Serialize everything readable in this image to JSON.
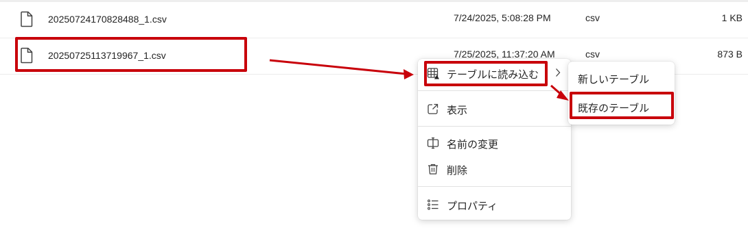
{
  "files": [
    {
      "name": "20250724170828488_1.csv",
      "modified": "7/24/2025, 5:08:28 PM",
      "type": "csv",
      "size": "1 KB",
      "icon": "file-icon"
    },
    {
      "name": "20250725113719967_1.csv",
      "modified": "7/25/2025, 11:37:20 AM",
      "type": "csv",
      "size": "873 B",
      "icon": "file-icon"
    }
  ],
  "context_menu": {
    "import_to_table": {
      "label": "テーブルに読み込む",
      "icon": "table-import-icon"
    },
    "view": {
      "label": "表示",
      "icon": "open-external-icon"
    },
    "rename": {
      "label": "名前の変更",
      "icon": "rename-icon"
    },
    "delete": {
      "label": "削除",
      "icon": "trash-icon"
    },
    "properties": {
      "label": "プロパティ",
      "icon": "properties-list-icon"
    }
  },
  "submenu": {
    "new_table": {
      "label": "新しいテーブル"
    },
    "existing_table": {
      "label": "既存のテーブル"
    }
  },
  "colors": {
    "annotation": "#c8000a",
    "text": "#242424",
    "divider": "#ececec"
  }
}
